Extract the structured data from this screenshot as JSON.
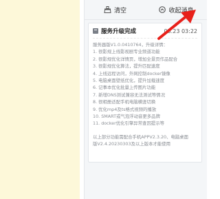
{
  "toolbar": {
    "clear_label": "清空",
    "mark_read_label": "收起消息"
  },
  "notification": {
    "title": "服务升级完成",
    "time": "03.23 03:22",
    "lines": [
      "服务器版V1.0.0410764，升级详情：",
      "1. 很影规上线影视剧专业频道功能",
      "2. 很影规优化详情页，增加全景页作品配合",
      "3. 很影规优化算法，提升匹配速度",
      "4. 上线远程访问，外网控制docker镜像",
      "5. 电脑桌面壁纸优化，提升加载速度",
      "6. 记事本优化批量上传图片功能",
      "7. 新增DNS测试兼容无法测试等情况",
      "8. 很相册适配手机电脑横竖切换",
      "9. 优化mp4及ts格式视频的播放",
      "10. SMART或气泡浮动音更多品牌",
      "11. docker优化引擎异常查因提示等"
    ],
    "footer_lines": [
      "以上部分功能需配合手机APPV2.3.20、电脑桌面",
      "版V2.4.20230303及以上版本才能使用"
    ]
  },
  "colors": {
    "arrow": "#e8201a",
    "panel_bg": "#f4f6f8",
    "left_bg": "#fdf8d9"
  }
}
